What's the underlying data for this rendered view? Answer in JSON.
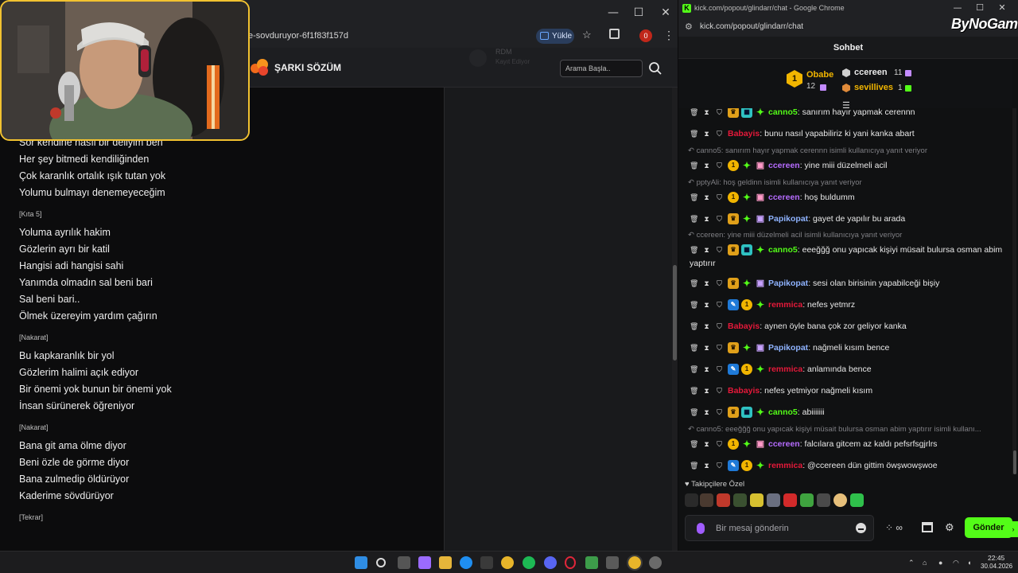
{
  "left_browser": {
    "url_fragment": "e-sovduruyor-6f1f83f157d",
    "upload_label": "Yükle",
    "profile_badge": "0",
    "site_logo": "ŞARKI SÖZÜM",
    "ghost_name": "RDM",
    "ghost_sub": "Kayıt Ediyor",
    "search_placeholder": "Arama Başla..",
    "lyrics": [
      {
        "type": "line",
        "text": "Sor kendine nasıl bir deliyim ben"
      },
      {
        "type": "line",
        "text": "Her şey bitmedi kendiliğinden"
      },
      {
        "type": "line",
        "text": "Çok karanlık ortalık ışık tutan yok"
      },
      {
        "type": "line",
        "text": "Yolumu bulmayı denemeyeceğim"
      },
      {
        "type": "section",
        "text": "[Kıta 5]"
      },
      {
        "type": "line",
        "text": "Yoluma ayrılık hakim"
      },
      {
        "type": "line",
        "text": "Gözlerin ayrı bir katil"
      },
      {
        "type": "line",
        "text": "Hangisi adi hangisi sahi"
      },
      {
        "type": "line",
        "text": "Yanımda olmadın sal beni bari"
      },
      {
        "type": "line",
        "text": "Sal beni bari.."
      },
      {
        "type": "line",
        "text": "Ölmek üzereyim yardım çağırın"
      },
      {
        "type": "section",
        "text": "[Nakarat]"
      },
      {
        "type": "line",
        "text": "Bu kapkaranlık bir yol"
      },
      {
        "type": "line",
        "text": "Gözlerim halimi açık ediyor"
      },
      {
        "type": "line",
        "text": "Bir önemi yok bunun bir önemi yok"
      },
      {
        "type": "line",
        "text": "İnsan sürünerek öğreniyor"
      },
      {
        "type": "section",
        "text": "[Nakarat]"
      },
      {
        "type": "line",
        "text": "Bana git ama ölme diyor"
      },
      {
        "type": "line",
        "text": "Beni özle de görme diyor"
      },
      {
        "type": "line",
        "text": "Bana zulmedip öldürüyor"
      },
      {
        "type": "line",
        "text": "Kaderime sövdürüyor"
      },
      {
        "type": "section",
        "text": "[Tekrar]"
      }
    ]
  },
  "chat_window": {
    "window_title": "kick.com/popout/glindarr/chat - Google Chrome",
    "url": "kick.com/popout/glindarr/chat",
    "watermark": "ByNoGame",
    "header_title": "Sohbet",
    "gifters": {
      "first": {
        "rank": "1",
        "name": "Obabe",
        "count": "12"
      },
      "second": {
        "name": "ccereen",
        "count": "11"
      },
      "third": {
        "name": "sevillives",
        "count": "1"
      }
    },
    "messages": [
      {
        "kind": "msg",
        "badges": [
          "crown",
          "vip",
          "star"
        ],
        "user": "canno5",
        "color": "#53fc18",
        "text": "sanırım hayır yapmak cerennn",
        "clipped": true
      },
      {
        "kind": "msg",
        "badges": [],
        "user": "Babayis",
        "color": "#e5193a",
        "text": "bunu nasıl yapabiliriz ki yani kanka abart"
      },
      {
        "kind": "reply",
        "text": "canno5: sanırım hayır yapmak cerennn isimli kullanıcıya yanıt veriyor"
      },
      {
        "kind": "msg",
        "badges": [
          "sub",
          "star",
          "gift"
        ],
        "user": "ccereen",
        "color": "#b66cff",
        "text": "yine miii düzelmeli acil"
      },
      {
        "kind": "reply",
        "text": "pptyAli: hoş geldinn isimli kullanıcıya yanıt veriyor"
      },
      {
        "kind": "msg",
        "badges": [
          "sub",
          "star",
          "gift"
        ],
        "user": "ccereen",
        "color": "#b66cff",
        "text": "hoş buldumm"
      },
      {
        "kind": "msg",
        "badges": [
          "crown",
          "star",
          "gift2"
        ],
        "user": "Papikopat",
        "color": "#8fb3ff",
        "text": "gayet de yapılır bu arada"
      },
      {
        "kind": "reply",
        "text": "ccereen: yine miii düzelmeli acil isimli kullanıcıya yanıt veriyor"
      },
      {
        "kind": "msg",
        "badges": [
          "crown",
          "vip",
          "star"
        ],
        "user": "canno5",
        "color": "#53fc18",
        "text": "eeeğğğ onu yapıcak kişiyi müsait bulursa osman abim yaptırır"
      },
      {
        "kind": "msg",
        "badges": [
          "crown",
          "star",
          "gift2"
        ],
        "user": "Papikopat",
        "color": "#8fb3ff",
        "text": "sesi olan birisinin yapabilceği bişiy"
      },
      {
        "kind": "msg",
        "badges": [
          "mod",
          "sub",
          "star"
        ],
        "user": "remmica",
        "color": "#e5193a",
        "text": "nefes yetmrz"
      },
      {
        "kind": "msg",
        "badges": [],
        "user": "Babayis",
        "color": "#e5193a",
        "text": "aynen öyle bana çok zor geliyor kanka"
      },
      {
        "kind": "msg",
        "badges": [
          "crown",
          "star",
          "gift2"
        ],
        "user": "Papikopat",
        "color": "#8fb3ff",
        "text": "nağmeli kısım bence"
      },
      {
        "kind": "msg",
        "badges": [
          "mod",
          "sub",
          "star"
        ],
        "user": "remmica",
        "color": "#e5193a",
        "text": "anlamında bence"
      },
      {
        "kind": "msg",
        "badges": [],
        "user": "Babayis",
        "color": "#e5193a",
        "text": "nefes yetmiyor nağmeli kısım"
      },
      {
        "kind": "msg",
        "badges": [
          "crown",
          "vip",
          "star"
        ],
        "user": "canno5",
        "color": "#53fc18",
        "text": "abiiiiiii"
      },
      {
        "kind": "reply",
        "text": "canno5: eeeğğğ onu yapıcak kişiyi müsait bulursa osman abim yaptırır isimli kullanı..."
      },
      {
        "kind": "msg",
        "badges": [
          "sub",
          "star",
          "gift"
        ],
        "user": "ccereen",
        "color": "#b66cff",
        "text": "falcılara gitcem az kaldı pefsrfsgjrlrs"
      },
      {
        "kind": "msg",
        "badges": [
          "mod",
          "sub",
          "star"
        ],
        "user": "remmica",
        "color": "#e5193a",
        "text": "@ccereen dün gittim öwşwowşwoe"
      }
    ],
    "follower_label": "Takipçilere Özel",
    "input_placeholder": "Bir mesaj gönderin",
    "channel_points": "∞",
    "send_label": "Gönder"
  },
  "taskbar": {
    "time": "22:45",
    "date": "30.04.2026"
  },
  "colors": {
    "kick_green": "#53fc18",
    "webcam_border": "#f2c230",
    "gold": "#f1b500"
  }
}
